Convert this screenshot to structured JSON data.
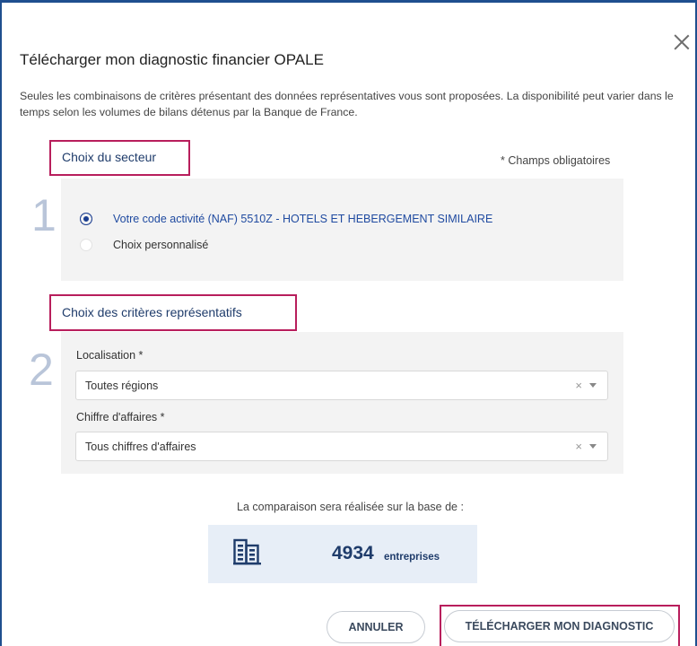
{
  "dialog": {
    "title": "Télécharger mon diagnostic financier OPALE",
    "intro": "Seules les combinaisons de critères présentant des données représentatives vous sont proposées. La disponibilité peut varier dans le temps selon les volumes de bilans détenus par la Banque de France.",
    "close_icon": "close-icon"
  },
  "sector": {
    "step": "1",
    "title": "Choix du secteur",
    "required_note": "* Champs obligatoires",
    "options": [
      {
        "label": "Votre code activité (NAF) 5510Z - HOTELS ET HEBERGEMENT SIMILAIRE",
        "selected": true
      },
      {
        "label": "Choix personnalisé",
        "selected": false
      }
    ]
  },
  "criteria": {
    "step": "2",
    "title": "Choix des critères représentatifs",
    "location": {
      "label": "Localisation *",
      "value": "Toutes régions",
      "clear": "×"
    },
    "revenue": {
      "label": "Chiffre d'affaires *",
      "value": "Tous chiffres d'affaires",
      "clear": "×"
    }
  },
  "comparison": {
    "text": "La comparaison sera réalisée sur la base de :",
    "count": "4934",
    "unit": "entreprises",
    "icon": "building-icon"
  },
  "actions": {
    "cancel": "ANNULER",
    "download": "TÉLÉCHARGER MON DIAGNOSTIC"
  },
  "colors": {
    "accent": "#1f4f8f",
    "highlight": "#b81e5c",
    "panel": "#f3f3f3"
  }
}
